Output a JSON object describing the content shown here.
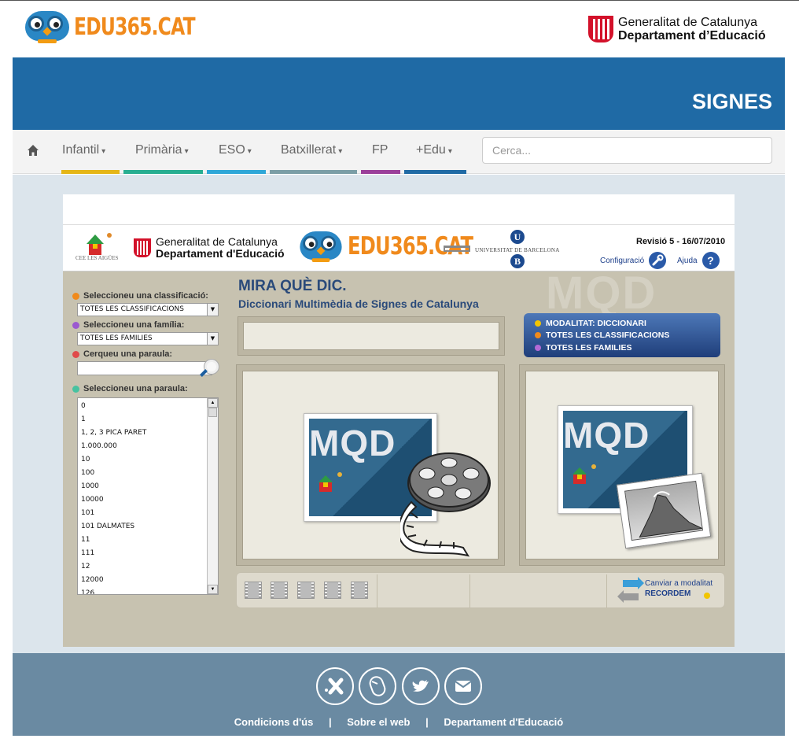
{
  "header": {
    "brand": "EDU365.CAT",
    "gov_line1": "Generalitat de Catalunya",
    "gov_line2": "Departament d’Educació"
  },
  "banner": {
    "title": "SIGNES"
  },
  "nav": {
    "items": [
      {
        "label": "Infantil",
        "caret": "▾",
        "color": "#e5b617"
      },
      {
        "label": "Primària",
        "caret": "▾",
        "color": "#27ae91"
      },
      {
        "label": "ESO",
        "caret": "▾",
        "color": "#2ea7d8"
      },
      {
        "label": "Batxillerat",
        "caret": "▾",
        "color": "#7b9ea6"
      },
      {
        "label": "FP",
        "caret": "",
        "color": "#9b3f9a"
      },
      {
        "label": "+Edu",
        "caret": "▾",
        "color": "#1f6aa5"
      }
    ],
    "search_placeholder": "Cerca..."
  },
  "app": {
    "cee_text": "CEE LES AIGÜES",
    "gov_line1": "Generalitat de Catalunya",
    "gov_line2": "Departament d'Educació",
    "brand": "EDU365.CAT",
    "ub_name": "UNIVERSITAT DE BARCELONA",
    "ub_u": "U",
    "ub_b": "B",
    "revision": "Revisió 5 - 16/07/2010",
    "config_label": "Configuració",
    "help_label": "Ajuda",
    "help_glyph": "?",
    "title": "MIRA QUÈ DIC.",
    "subtitle": "Diccionari Multimèdia de Signes de Catalunya",
    "watermark": "MQD",
    "left": {
      "classification_label": "Seleccioneu una classificació:",
      "classification_value": "TOTES LES CLASSIFICACIONS",
      "family_label": "Seleccioneu una família:",
      "family_value": "TOTES LES FAMILIES",
      "search_label": "Cerqueu una paraula:",
      "word_label": "Seleccioneu una paraula:",
      "words": [
        "0",
        "1",
        "1, 2, 3 PICA PARET",
        "1.000.000",
        "10",
        "100",
        "1000",
        "10000",
        "101",
        "101 DALMATES",
        "11",
        "111",
        "12",
        "12000",
        "126"
      ],
      "bullet_colors": [
        "#f08a1c",
        "#9b59d0",
        "#e04a4a",
        "#47c2a0"
      ]
    },
    "mode": {
      "lines": [
        {
          "text": "MODALITAT: DICCIONARI",
          "color": "#f2c500"
        },
        {
          "text": "TOTES LES CLASSIFICACIONS",
          "color": "#f08a1c"
        },
        {
          "text": "TOTES LES FAMILIES",
          "color": "#b46ad6"
        }
      ]
    },
    "card_text": "MQD",
    "switch_line1": "Canviar a modalitat",
    "switch_line2": "RECORDEM"
  },
  "footer": {
    "icons": [
      "xtec-icon",
      "mouse-icon",
      "twitter-icon",
      "mail-icon"
    ],
    "links": [
      "Condicions d'ús",
      "Sobre el web",
      "Departament d'Educació"
    ],
    "separator": "|"
  }
}
